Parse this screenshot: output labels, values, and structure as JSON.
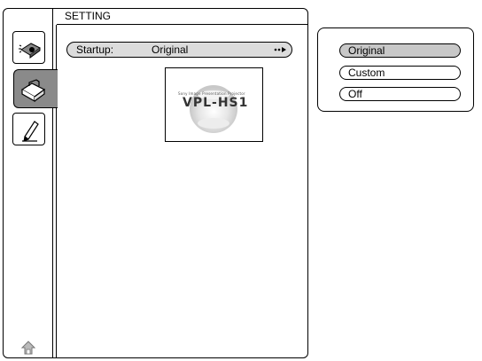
{
  "panel": {
    "title": "SETTING"
  },
  "sidebar": {
    "tabs": [
      {
        "name": "projector-icon",
        "active": false
      },
      {
        "name": "toolbox-icon",
        "active": true
      },
      {
        "name": "pen-icon",
        "active": false
      }
    ]
  },
  "setting": {
    "label": "Startup:",
    "value": "Original"
  },
  "preview": {
    "small_text": "Sony Image Presentation Projector",
    "logo_text": "VPL-HS1"
  },
  "popup": {
    "options": [
      "Original",
      "Custom",
      "Off"
    ],
    "selected": "Original"
  }
}
